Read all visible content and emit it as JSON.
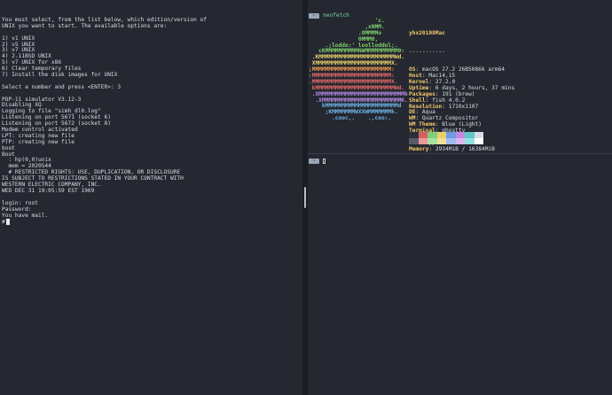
{
  "left_terminal": {
    "lines": [
      "You must select, from the list below, which edition/version of",
      "UNIX you want to start. The available options are:",
      "",
      "1) v1 UNIX",
      "2) v5 UNIX",
      "3) v7 UNIX",
      "4) 2.11BSD UNIX",
      "5) v7 UNIX for x86",
      "6) Clear temporary files",
      "7) Install the disk images for UNIX",
      "",
      "Select a number and press <ENTER>: 3",
      "",
      "PDP-11 simulator V3.12-3",
      "Disabling XQ",
      "Logging to file \"simh_dl0.log\"",
      "Listening on port 5671 (socket 6)",
      "Listening on port 5672 (socket 8)",
      "Modem control activated",
      "LPT: creating new file",
      "PTP: creating new file",
      "boot",
      "Boot",
      "  : hp(0,0)unix",
      "  mem = 2020544",
      "  # RESTRICTED RIGHTS: USE, DUPLICATION, OR DISCLOSURE",
      "IS SUBJECT TO RESTRICTIONS STATED IN YOUR CONTRACT WITH",
      "WESTERN ELECTRIC COMPANY, INC.",
      "WED DEC 31 19:05:59 EST 1969",
      "",
      "login: root",
      "Password:",
      "You have mail."
    ],
    "shell_prompt": "#"
  },
  "right_top": {
    "prompt_badge": "~",
    "command": "neofetch",
    "logo_lines": [
      {
        "text": "                    'c.",
        "color": "#7fd36b"
      },
      {
        "text": "                 ,xNMM.",
        "color": "#7fd36b"
      },
      {
        "text": "               .OMMMMo",
        "color": "#7fd36b"
      },
      {
        "text": "               OMMM0,",
        "color": "#7fd36b"
      },
      {
        "text": "     .;loddo:' loolloddol;.",
        "color": "#7fd36b"
      },
      {
        "text": "   cKMMMMMMMMMMNWMMMMMMMMMM0:",
        "color": "#7fd36b"
      },
      {
        "text": " .KMMMMMMMMMMMMMMMMMMMMMMMWd.",
        "color": "#e8d36a"
      },
      {
        "text": " XMMMMMMMMMMMMMMMMMMMMMMMX.",
        "color": "#e8d36a"
      },
      {
        "text": ";MMMMMMMMMMMMMMMMMMMMMMMM:",
        "color": "#f09a4e"
      },
      {
        "text": ":MMMMMMMMMMMMMMMMMMMMMMMM:",
        "color": "#e86a6a"
      },
      {
        "text": ".MMMMMMMMMMMMMMMMMMMMMMMMX.",
        "color": "#e86a6a"
      },
      {
        "text": " kMMMMMMMMMMMMMMMMMMMMMMMMWd.",
        "color": "#e86a6a"
      },
      {
        "text": " .XMMMMMMMMMMMMMMMMMMMMMMMMMMk",
        "color": "#b88ae6"
      },
      {
        "text": "  .XMMMMMMMMMMMMMMMMMMMMMMMMK.",
        "color": "#b88ae6"
      },
      {
        "text": "    kMMMMMMMMMMMMMMMMMMMMMMd",
        "color": "#6fb6e8"
      },
      {
        "text": "     ;KMMMMMMMWXXWMMMMMMMk.",
        "color": "#6fb6e8"
      },
      {
        "text": "       .cooc,.    .,coo:.",
        "color": "#6fb6e8"
      }
    ],
    "info": {
      "title": "yhx20108Mac",
      "rule": "-----------",
      "rows": [
        {
          "key": "OS",
          "value": "macOS 27.2 26B5086k arm64"
        },
        {
          "key": "Host",
          "value": "Mac14,15"
        },
        {
          "key": "Kernel",
          "value": "27.2.0"
        },
        {
          "key": "Uptime",
          "value": "6 days, 2 hours, 37 mins"
        },
        {
          "key": "Packages",
          "value": "191 (brew)"
        },
        {
          "key": "Shell",
          "value": "fish 4.0.2"
        },
        {
          "key": "Resolution",
          "value": "1710x1107"
        },
        {
          "key": "DE",
          "value": "Aqua"
        },
        {
          "key": "WM",
          "value": "Quartz Compositor"
        },
        {
          "key": "WM Theme",
          "value": "Blue (Light)"
        },
        {
          "key": "Terminal",
          "value": "ghostty"
        },
        {
          "key": "CPU",
          "value": "Apple M2"
        },
        {
          "key": "GPU",
          "value": "Apple M2"
        },
        {
          "key": "Memory",
          "value": "2934MiB / 16384MiB"
        }
      ]
    },
    "palette_top": [
      "#2b2e36",
      "#d65f5f",
      "#7fcf7a",
      "#e8cf6a",
      "#6e9be6",
      "#c48ae0",
      "#5fc8c8",
      "#d8dde6"
    ],
    "palette_bottom": [
      "#575b66",
      "#e89a9a",
      "#a8e2a0",
      "#f0df95",
      "#9dbcf0",
      "#dab5ee",
      "#95e0e0",
      "#ffffff"
    ]
  },
  "right_bottom": {
    "prompt_badge": "~"
  }
}
